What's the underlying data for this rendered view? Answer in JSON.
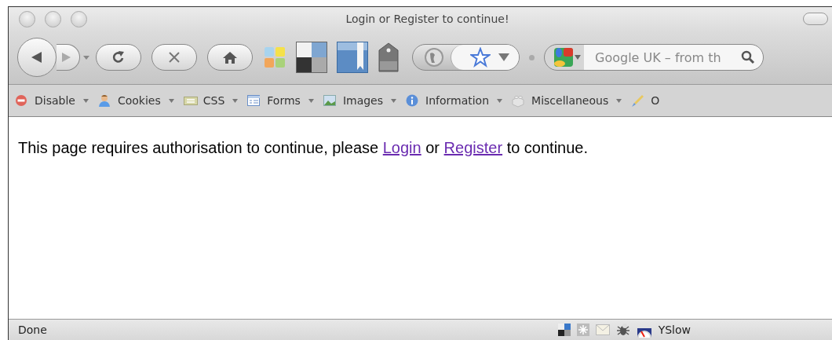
{
  "window": {
    "title": "Login or Register to continue!"
  },
  "toolbar": {
    "search": {
      "placeholder": "Google UK – from th"
    }
  },
  "dev_toolbar": {
    "items": [
      {
        "label": "Disable",
        "kind": "disable"
      },
      {
        "label": "Cookies",
        "kind": "cookies"
      },
      {
        "label": "CSS",
        "kind": "css"
      },
      {
        "label": "Forms",
        "kind": "forms"
      },
      {
        "label": "Images",
        "kind": "images"
      },
      {
        "label": "Information",
        "kind": "information"
      },
      {
        "label": "Miscellaneous",
        "kind": "miscellaneous"
      },
      {
        "label": "O",
        "kind": "outline"
      }
    ]
  },
  "content": {
    "message": [
      {
        "kind": "text",
        "text": "This page requires authorisation to continue, please "
      },
      {
        "kind": "link",
        "text": "Login"
      },
      {
        "kind": "text",
        "text": " or "
      },
      {
        "kind": "link",
        "text": "Register"
      },
      {
        "kind": "text",
        "text": " to continue."
      }
    ]
  },
  "status_bar": {
    "text": "Done",
    "yslow": "YSlow"
  }
}
